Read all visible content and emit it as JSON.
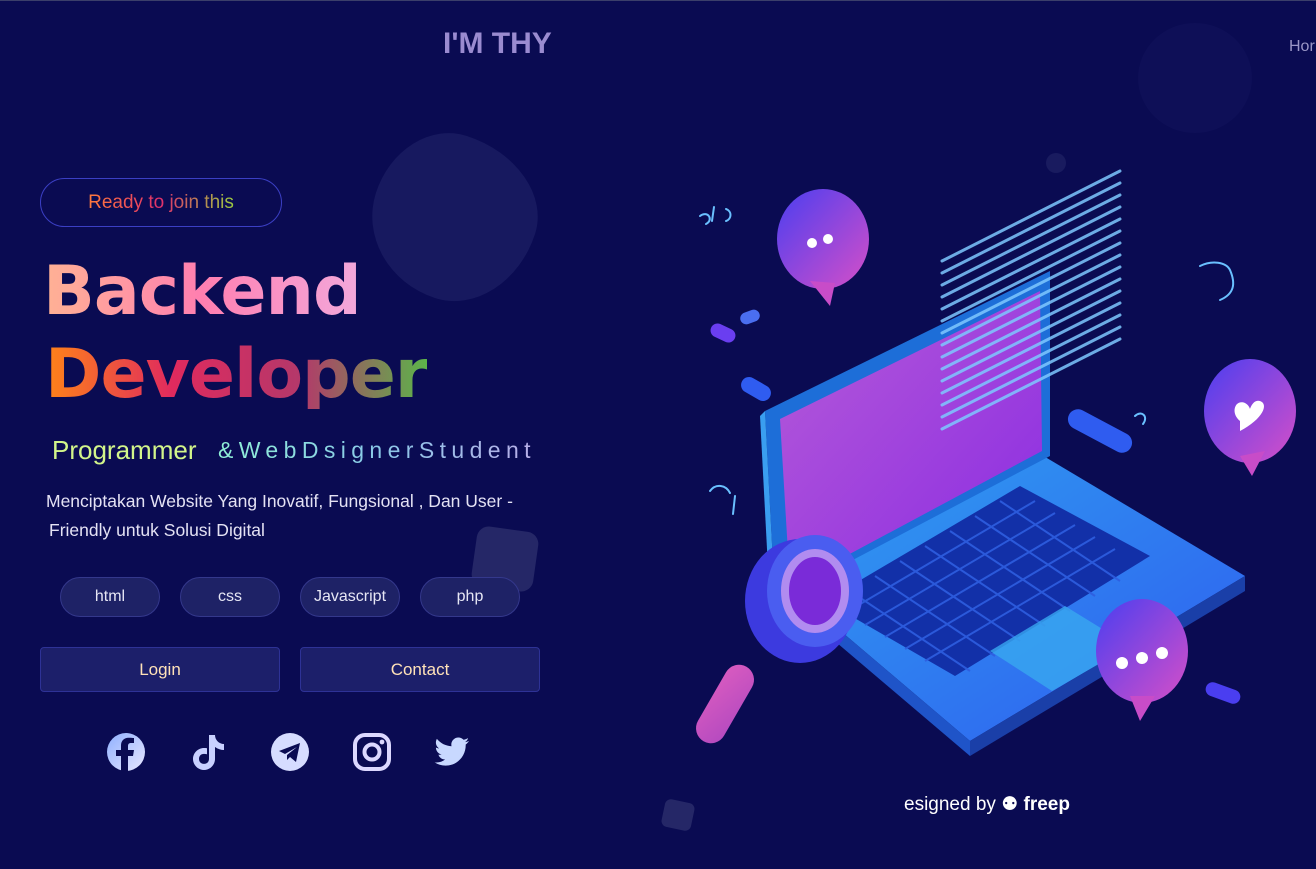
{
  "nav": {
    "brand": "I'M THY",
    "link_home": "Hor"
  },
  "hero": {
    "badge": "Ready to join this",
    "title_line1": "Backend",
    "title_line2": "Developer",
    "role": "Programmer",
    "role_sub": "&WebDsignerStudent",
    "description_line1": "Menciptakan Website Yang Inovatif, Fungsional , Dan User -",
    "description_line2": "Friendly untuk Solusi Digital"
  },
  "skills": [
    "html",
    "css",
    "Javascript",
    "php"
  ],
  "actions": {
    "login": "Login",
    "contact": "Contact"
  },
  "social": [
    "facebook-icon",
    "tiktok-icon",
    "telegram-icon",
    "instagram-icon",
    "twitter-icon"
  ],
  "credit": {
    "prefix": "esigned by",
    "brand": "freep"
  },
  "colors": {
    "background": "#0a0b52",
    "button": "#1c1f6a",
    "accent_gradient_start": "#ff8418"
  }
}
